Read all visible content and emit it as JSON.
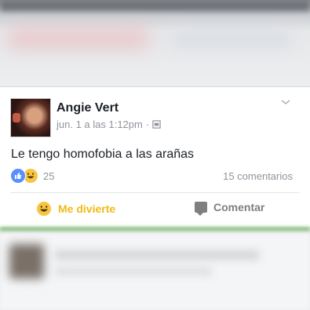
{
  "post": {
    "author": "Angie Vert",
    "timestamp": "jun. 1 a las 1:12pm",
    "separator": "·",
    "text": "Le tengo homofobia a las arañas",
    "reaction_count": "25",
    "comments_count": "15 comentarios"
  },
  "actions": {
    "react_label": "Me divierte",
    "comment_label": "Comentar"
  },
  "icons": {
    "reactions": [
      "like-icon",
      "haha-icon"
    ],
    "privacy": "globe-icon",
    "menu": "chevron-down-icon"
  },
  "colors": {
    "haha_accent": "#f0ba15",
    "like_blue": "#5890ff",
    "muted_text": "#90949c"
  }
}
